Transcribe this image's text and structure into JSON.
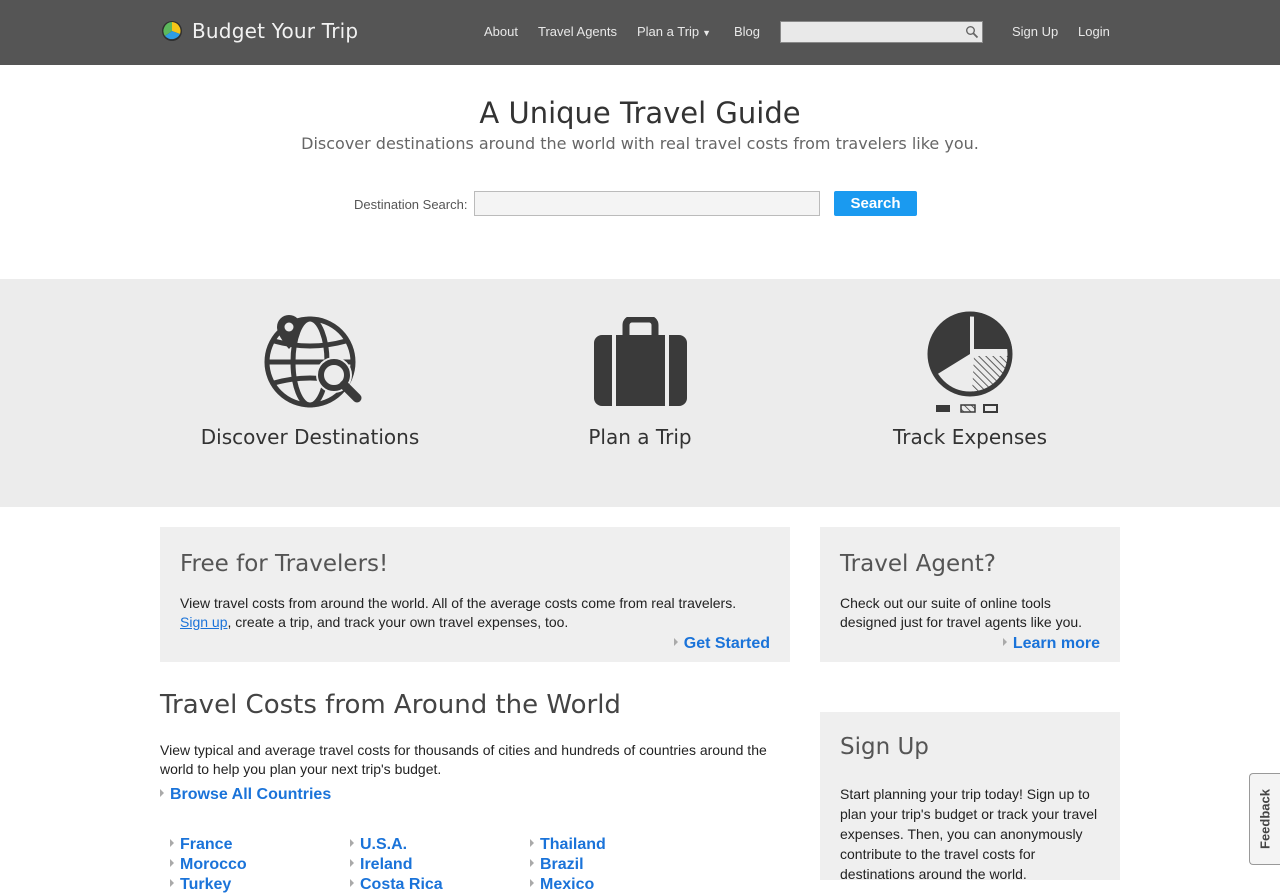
{
  "header": {
    "site_name": "Budget Your Trip",
    "nav": {
      "about": "About",
      "travel_agents": "Travel Agents",
      "plan_a_trip": "Plan a Trip",
      "blog": "Blog",
      "sign_up": "Sign Up",
      "login": "Login"
    },
    "search_value": ""
  },
  "hero": {
    "title": "A Unique Travel Guide",
    "subtitle": "Discover destinations around the world with real travel costs from travelers like you.",
    "search_label": "Destination Search:",
    "search_value": "",
    "search_button": "Search"
  },
  "features": [
    {
      "label": "Discover Destinations",
      "icon": "globe-search-icon"
    },
    {
      "label": "Plan a Trip",
      "icon": "suitcase-icon"
    },
    {
      "label": "Track Expenses",
      "icon": "pie-chart-icon"
    }
  ],
  "free_card": {
    "title": "Free for Travelers!",
    "text_1": "View travel costs from around the world. All of the average costs come from real travelers.",
    "sign_up_link": "Sign up",
    "text_2": ", create a trip, and track your own travel expenses, too.",
    "cta": "Get Started"
  },
  "agent_card": {
    "title": "Travel Agent?",
    "text": "Check out our suite of online tools designed just for travel agents like you.",
    "cta": "Learn more"
  },
  "costs_section": {
    "title": "Travel Costs from Around the World",
    "text": "View typical and average travel costs for thousands of cities and hundreds of countries around the world to help you plan your next trip's budget.",
    "browse": "Browse All Countries",
    "countries": [
      [
        "France",
        "Morocco",
        "Turkey"
      ],
      [
        "U.S.A.",
        "Ireland",
        "Costa Rica"
      ],
      [
        "Thailand",
        "Brazil",
        "Mexico"
      ]
    ]
  },
  "signup_card": {
    "title": "Sign Up",
    "text": "Start planning your trip today! Sign up to plan your trip's budget or track your travel expenses. Then, you can anonymously contribute to the travel costs for destinations around the world."
  },
  "feedback": "Feedback",
  "colors": {
    "header_bg": "#555555",
    "accent_blue": "#1a9af0",
    "link_blue": "#1a73d9",
    "band_bg": "#ececec",
    "icon_dark": "#3a3a3a"
  }
}
